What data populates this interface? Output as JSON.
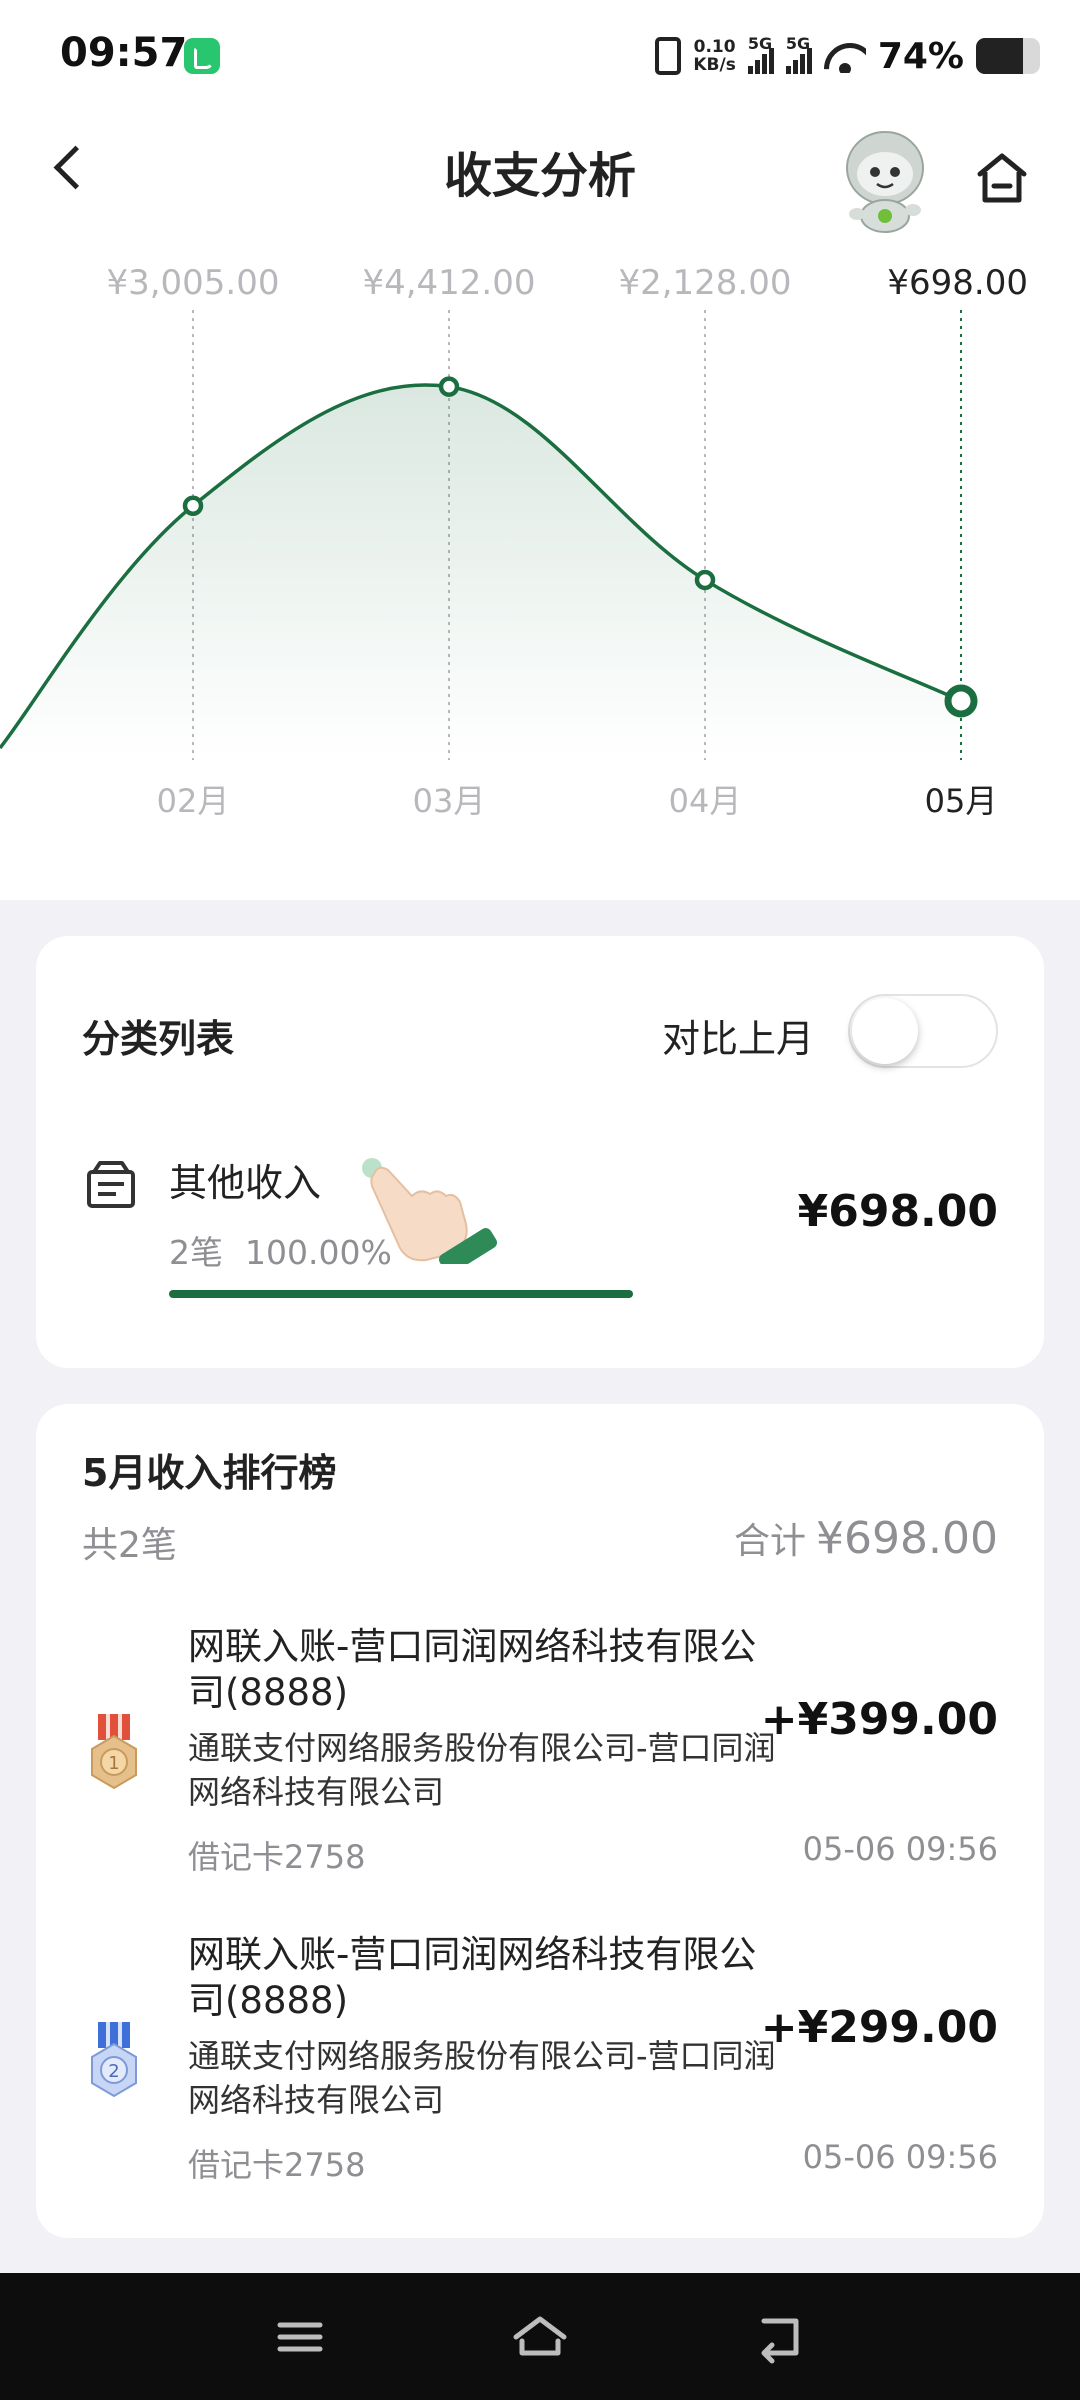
{
  "status_bar": {
    "time": "09:57",
    "speed_value": "0.10",
    "speed_unit": "KB/s",
    "network_1": "5G",
    "network_2": "5G",
    "battery_text": "74%",
    "battery_level": 0.74
  },
  "header": {
    "title": "收支分析",
    "back_icon": "back-arrow-icon",
    "home_icon": "home-icon"
  },
  "chart_data": {
    "type": "area",
    "categories": [
      "02月",
      "03月",
      "04月",
      "05月"
    ],
    "values": [
      3005.0,
      4412.0,
      2128.0,
      698.0
    ],
    "value_labels": [
      "¥3,005.00",
      "¥4,412.00",
      "¥2,128.00",
      "¥698.00"
    ],
    "selected_index": 3,
    "ylim": [
      0,
      5200
    ],
    "grid": false,
    "colors": {
      "line": "#1a6e3f",
      "label_active": "#222222",
      "label_inactive": "#b8b8bc"
    }
  },
  "category_list": {
    "title": "分类列表",
    "compare_label": "对比上月",
    "compare_enabled": false,
    "items": [
      {
        "icon": "other-income-icon",
        "name": "其他收入",
        "count": "2笔",
        "percent": "100.00%",
        "amount": "¥698.00",
        "share": 1.0
      }
    ]
  },
  "ranking": {
    "title": "5月收入排行榜",
    "count": "共2笔",
    "total_label": "合计",
    "total_amount": "¥698.00",
    "items": [
      {
        "medal": "medal-1-icon",
        "name": "网联入账-营口同润网络科技有限公司(8888)",
        "sub": "通联支付网络服务股份有限公司-营口同润网络科技有限公司",
        "card": "借记卡2758",
        "amount": "+¥399.00",
        "time": "05-06 09:56"
      },
      {
        "medal": "medal-2-icon",
        "name": "网联入账-营口同润网络科技有限公司(8888)",
        "sub": "通联支付网络服务股份有限公司-营口同润网络科技有限公司",
        "card": "借记卡2758",
        "amount": "+¥299.00",
        "time": "05-06 09:56"
      }
    ]
  },
  "colors": {
    "accent": "#1a6e3f",
    "page_bg": "#f2f2f6",
    "card_bg": "#ffffff",
    "muted_text": "#8e8e93",
    "nav_bg": "#0d0d0d"
  }
}
